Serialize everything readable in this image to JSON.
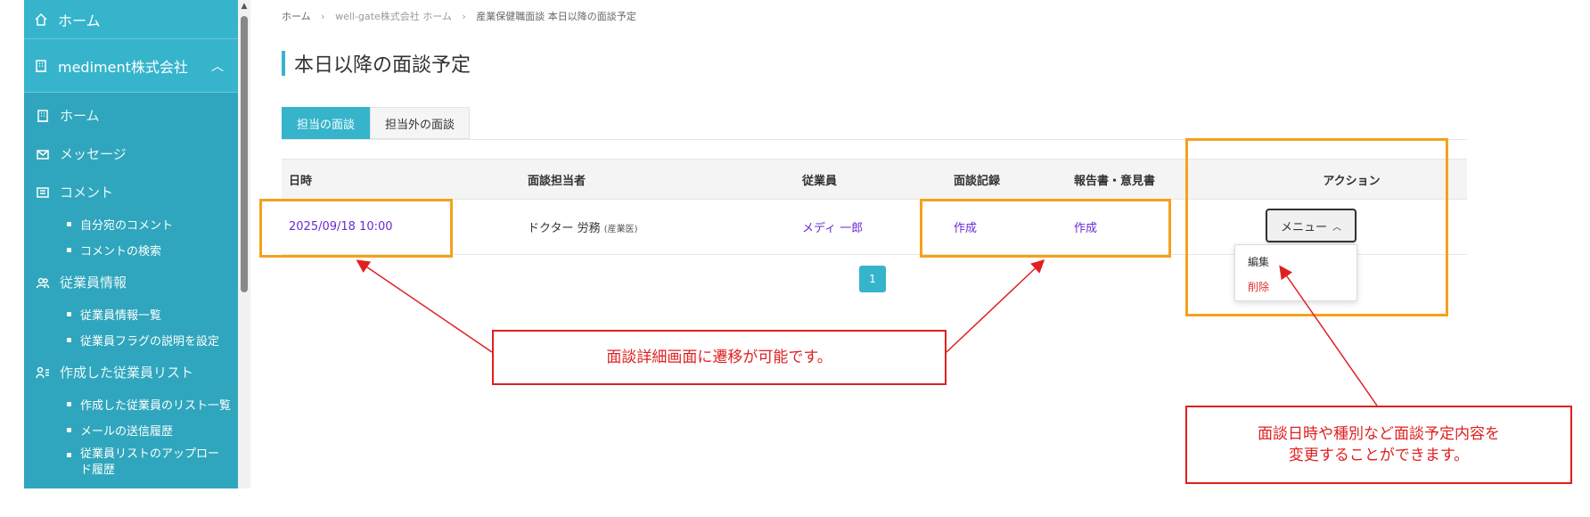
{
  "sidebar": {
    "home": "ホーム",
    "company": "mediment株式会社",
    "items": [
      {
        "label": "ホーム",
        "icon": "building-icon"
      },
      {
        "label": "メッセージ",
        "icon": "mail-icon"
      },
      {
        "label": "コメント",
        "icon": "comment-icon"
      }
    ],
    "comment_children": [
      "自分宛のコメント",
      "コメントの検索"
    ],
    "employee_info": "従業員情報",
    "employee_children": [
      "従業員情報一覧",
      "従業員フラグの説明を設定"
    ],
    "created_list": "作成した従業員リスト",
    "created_children": [
      "作成した従業員のリスト一覧",
      "メールの送信履歴",
      "従業員リストのアップロード履歴"
    ]
  },
  "breadcrumb": {
    "home": "ホーム",
    "company_home": "well-gate株式会社 ホーム",
    "current": "産業保健職面談 本日以降の面談予定"
  },
  "page_title": "本日以降の面談予定",
  "tabs": [
    "担当の面談",
    "担当外の面談"
  ],
  "table": {
    "headers": [
      "日時",
      "面談担当者",
      "従業員",
      "面談記録",
      "報告書・意見書",
      "アクション"
    ],
    "row": {
      "datetime": "2025/09/18 10:00",
      "staff": "ドクター 労務",
      "staff_role": "(産業医)",
      "employee": "メディ 一郎",
      "record": "作成",
      "report": "作成"
    }
  },
  "menu": {
    "button": "メニュー",
    "items": [
      "編集",
      "削除"
    ]
  },
  "pagination": {
    "current": "1"
  },
  "annotations": {
    "callout1": "面談詳細画面に遷移が可能です。",
    "callout2_line1": "面談日時や種別など面談予定内容を",
    "callout2_line2": "変更することができます。"
  },
  "colors": {
    "accent": "#36b4cc",
    "link": "#6a2bd3",
    "highlight": "#f5a11c",
    "callout": "#e02020"
  }
}
